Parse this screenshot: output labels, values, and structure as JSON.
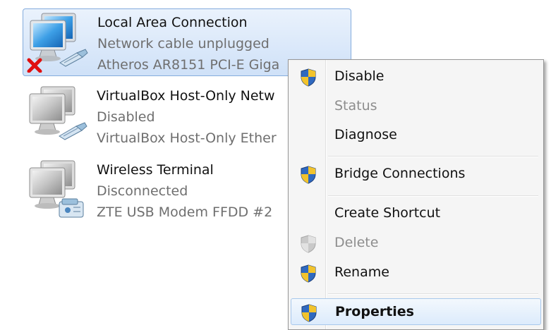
{
  "connections": [
    {
      "name": "Local Area Connection",
      "status": "Network cable unplugged",
      "device": "Atheros AR8151 PCI-E Giga",
      "icon": "network-adapter-disconnected-icon"
    },
    {
      "name": "VirtualBox Host-Only Netw",
      "status": "Disabled",
      "device": "VirtualBox Host-Only Ether",
      "icon": "network-adapter-disabled-icon"
    },
    {
      "name": "Wireless Terminal",
      "status": "Disconnected",
      "device": "ZTE USB Modem FFDD #2",
      "icon": "modem-adapter-icon"
    }
  ],
  "context_menu": {
    "items": [
      {
        "label": "Disable",
        "icon": "uac-shield-icon"
      },
      {
        "label": "Status"
      },
      {
        "label": "Diagnose"
      },
      {
        "label": "Bridge Connections",
        "icon": "uac-shield-icon"
      },
      {
        "label": "Create Shortcut"
      },
      {
        "label": "Delete",
        "icon": "uac-shield-disabled-icon"
      },
      {
        "label": "Rename",
        "icon": "uac-shield-icon"
      },
      {
        "label": "Properties",
        "icon": "uac-shield-icon"
      }
    ]
  },
  "colors": {
    "selection": "#cfe1f8",
    "menu_background": "#f5f5f5",
    "disabled_text": "#8d8d8d",
    "error_x": "#e01010"
  }
}
